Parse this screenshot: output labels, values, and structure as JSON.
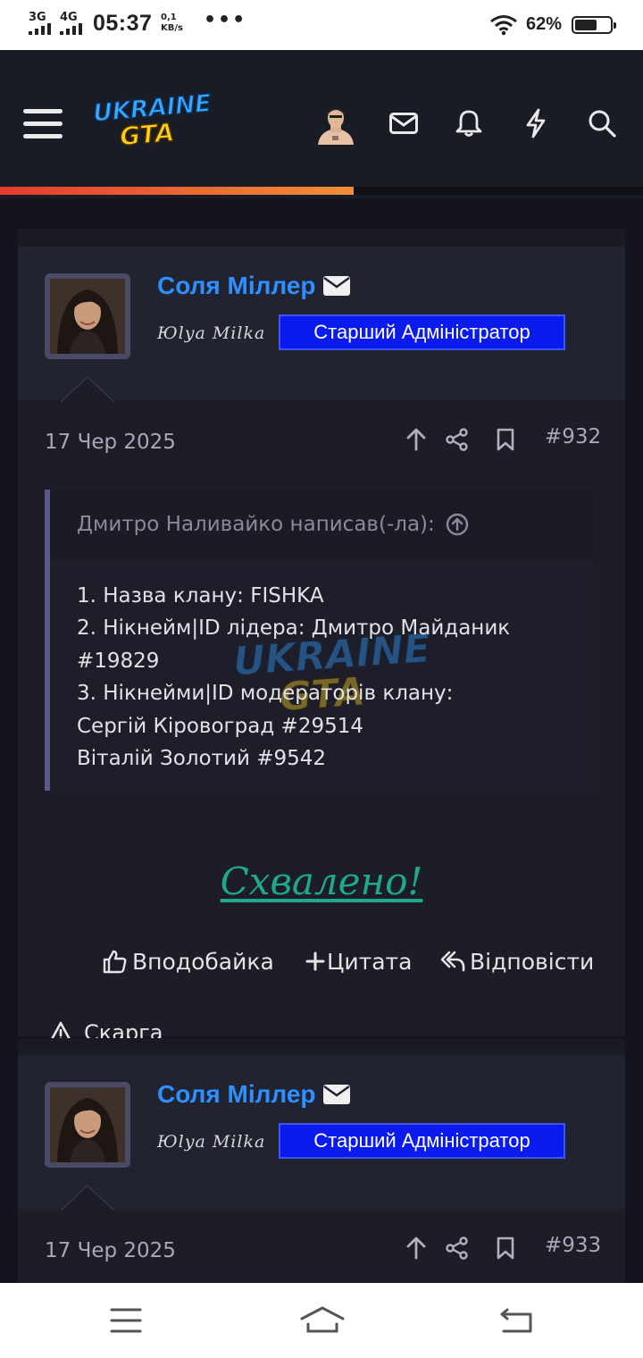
{
  "status_bar": {
    "net1": "3G",
    "net2": "4G",
    "time": "05:37",
    "speed_value": "0,1",
    "speed_unit": "KB/s",
    "dots": "•••",
    "battery_pct": "62%",
    "battery_level": 0.62
  },
  "header": {
    "logo_line1": "UKRAINE",
    "logo_line2": "GTA",
    "icons": [
      "menu-icon",
      "avatar",
      "mail-icon",
      "bell-icon",
      "bolt-icon",
      "search-icon"
    ],
    "reading_progress": 0.55,
    "accent_colors": [
      "#e73a2e",
      "#f08f3a"
    ]
  },
  "posts": [
    {
      "username": "Соля Міллер",
      "user_title": "Юlya Milka",
      "badge": "Старший Адміністратор",
      "date": "17 Чер 2025",
      "number": "#932",
      "quote": {
        "author": "Дмитро Наливайко написав(-ла):",
        "lines": [
          "1. Назва клану: FISHKA",
          "2. Нікнейм|ID лідера: Дмитро Майданик",
          "#19829",
          "3. Нікнейми|ID модераторів клану:",
          "Сергій Кіровоград #29514",
          "Віталій Золотий #9542"
        ]
      },
      "message": "Схвалено!",
      "actions": {
        "like": "Вподобайка",
        "quote": "Цитата",
        "reply": "Відповісти",
        "report": "Скарга"
      }
    },
    {
      "username": "Соля Міллер",
      "user_title": "Юlya Milka",
      "badge": "Старший Адміністратор",
      "date": "17 Чер 2025",
      "number": "#933"
    }
  ],
  "colors": {
    "username": "#2e8fff",
    "badge": "#0b1aed",
    "approved": "#1ea88c"
  }
}
